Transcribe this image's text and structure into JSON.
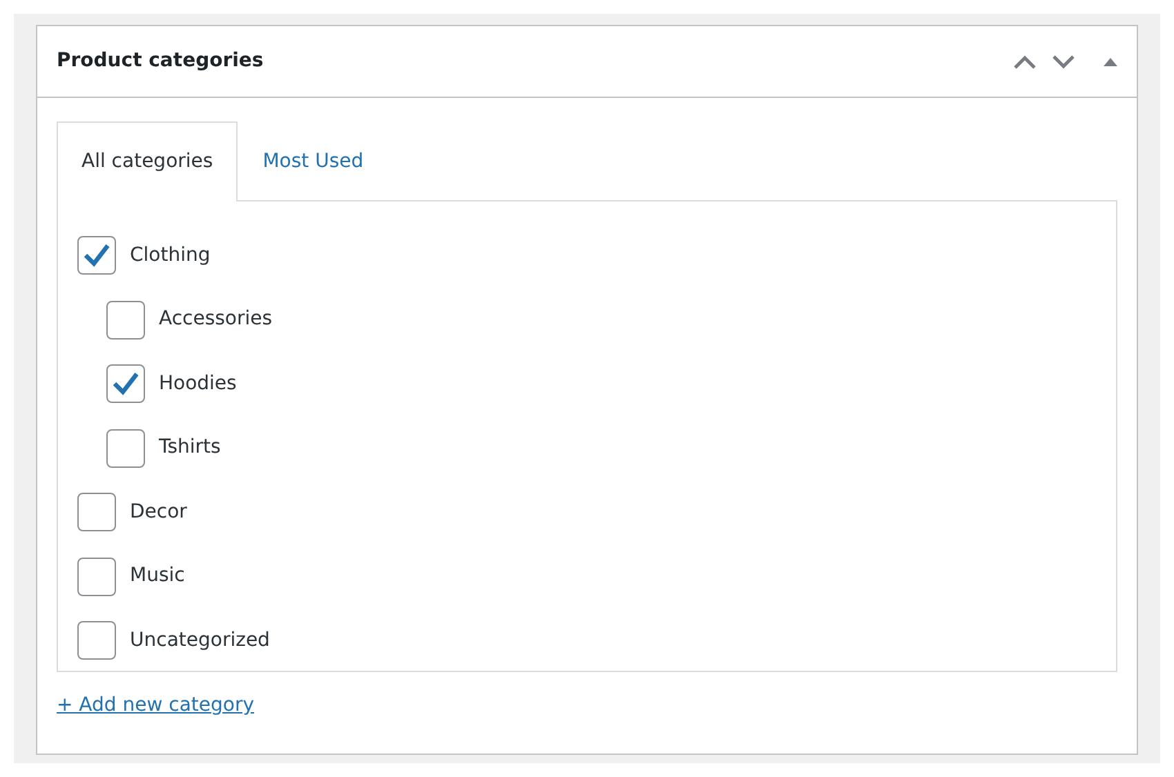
{
  "panel": {
    "title": "Product categories"
  },
  "tabs": [
    {
      "label": "All categories",
      "selected": true
    },
    {
      "label": "Most Used",
      "selected": false
    }
  ],
  "categories": [
    {
      "label": "Clothing",
      "checked": true,
      "children": [
        {
          "label": "Accessories",
          "checked": false
        },
        {
          "label": "Hoodies",
          "checked": true
        },
        {
          "label": "Tshirts",
          "checked": false
        }
      ]
    },
    {
      "label": "Decor",
      "checked": false
    },
    {
      "label": "Music",
      "checked": false
    },
    {
      "label": "Uncategorized",
      "checked": false
    }
  ],
  "add_link": "+ Add new category"
}
